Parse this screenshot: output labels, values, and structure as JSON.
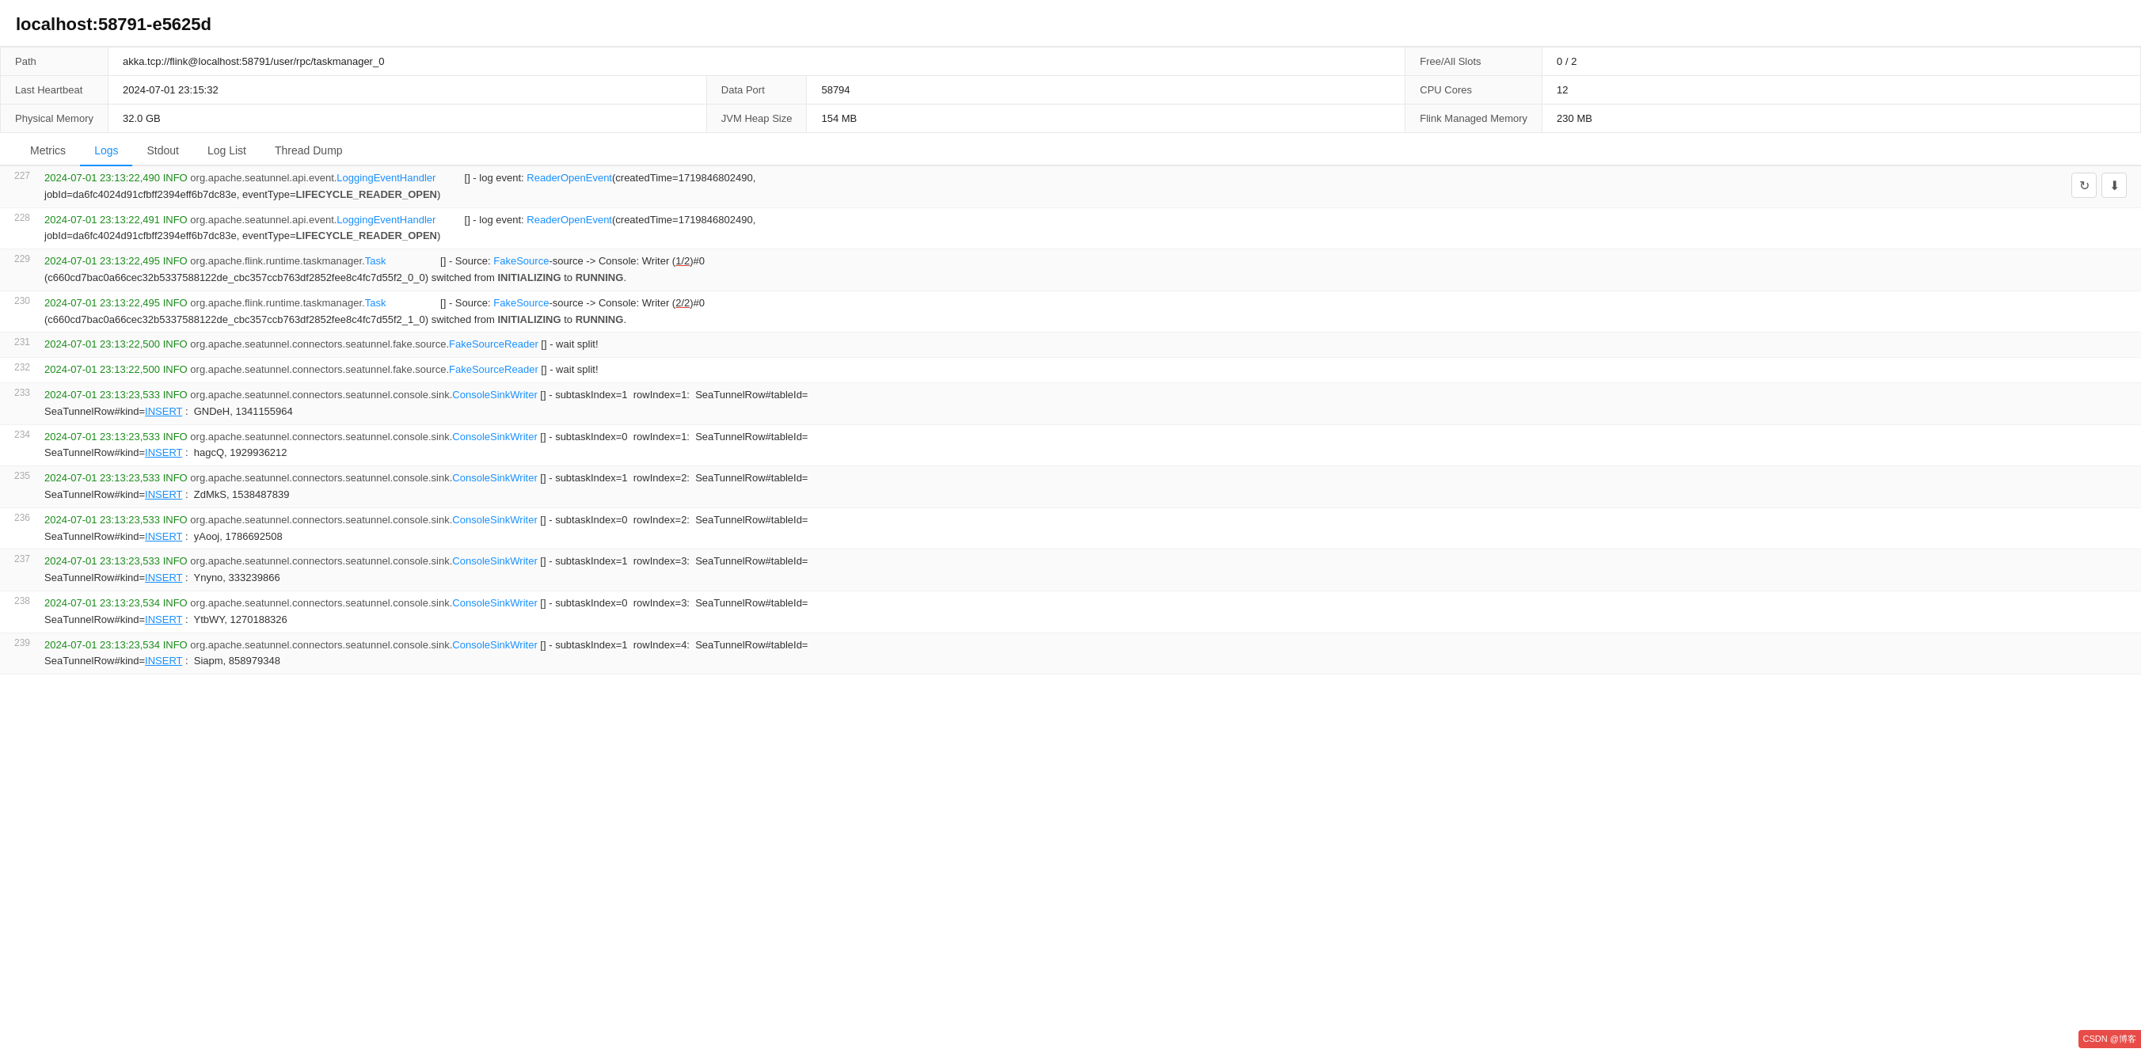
{
  "title": "localhost:58791-e5625d",
  "info": {
    "rows": [
      [
        {
          "label": "Path",
          "value": "akka.tcp://flink@localhost:58791/user/rpc/taskmanager_0"
        },
        {
          "label": "Free/All Slots",
          "value": "0 / 2"
        }
      ],
      [
        {
          "label": "Last Heartbeat",
          "value": "2024-07-01 23:15:32"
        },
        {
          "label": "Data Port",
          "value": "58794"
        },
        {
          "label": "CPU Cores",
          "value": "12"
        }
      ],
      [
        {
          "label": "Physical Memory",
          "value": "32.0 GB"
        },
        {
          "label": "JVM Heap Size",
          "value": "154 MB"
        },
        {
          "label": "Flink Managed Memory",
          "value": "230 MB"
        }
      ]
    ]
  },
  "tabs": [
    {
      "label": "Metrics",
      "active": false
    },
    {
      "label": "Logs",
      "active": true
    },
    {
      "label": "Stdout",
      "active": false
    },
    {
      "label": "Log List",
      "active": false
    },
    {
      "label": "Thread Dump",
      "active": false
    }
  ],
  "logs": [
    {
      "num": "227",
      "lines": [
        "2024-07-01 23:13:22,490 INFO  org.apache.seatunnel.api.event.LoggingEventHandler          [] - log event: ReaderOpenEvent(createdTime=1719846802490,",
        "jobId=da6fc4024d91cfbff2394eff6b7dc83e, eventType=LIFECYCLE_READER_OPEN)"
      ]
    },
    {
      "num": "228",
      "lines": [
        "2024-07-01 23:13:22,491 INFO  org.apache.seatunnel.api.event.LoggingEventHandler          [] - log event: ReaderOpenEvent(createdTime=1719846802490,",
        "jobId=da6fc4024d91cfbff2394eff6b7dc83e, eventType=LIFECYCLE_READER_OPEN)"
      ]
    },
    {
      "num": "229",
      "lines": [
        "2024-07-01 23:13:22,495 INFO  org.apache.flink.runtime.taskmanager.Task                   [] - Source: FakeSource-source -> Console: Writer (1/2)#0",
        "(c660cd7bac0a66cec32b5337588122de_cbc357ccb763df2852fee8c4fc7d55f2_0_0) switched from INITIALIZING to RUNNING."
      ]
    },
    {
      "num": "230",
      "lines": [
        "2024-07-01 23:13:22,495 INFO  org.apache.flink.runtime.taskmanager.Task                   [] - Source: FakeSource-source -> Console: Writer (2/2)#0",
        "(c660cd7bac0a66cec32b5337588122de_cbc357ccb763df2852fee8c4fc7d55f2_1_0) switched from INITIALIZING to RUNNING."
      ]
    },
    {
      "num": "231",
      "lines": [
        "2024-07-01 23:13:22,500 INFO  org.apache.seatunnel.connectors.seatunnel.fake.source.FakeSourceReader [] - wait split!"
      ]
    },
    {
      "num": "232",
      "lines": [
        "2024-07-01 23:13:22,500 INFO  org.apache.seatunnel.connectors.seatunnel.fake.source.FakeSourceReader [] - wait split!"
      ]
    },
    {
      "num": "233",
      "lines": [
        "2024-07-01 23:13:23,533 INFO  org.apache.seatunnel.connectors.seatunnel.console.sink.ConsoleSinkWriter [] - subtaskIndex=1  rowIndex=1:  SeaTunnelRow#tableId=",
        "SeaTunnelRow#kind=INSERT :  GNDeH, 1341155964"
      ]
    },
    {
      "num": "234",
      "lines": [
        "2024-07-01 23:13:23,533 INFO  org.apache.seatunnel.connectors.seatunnel.console.sink.ConsoleSinkWriter [] - subtaskIndex=0  rowIndex=1:  SeaTunnelRow#tableId=",
        "SeaTunnelRow#kind=INSERT :  hagcQ, 1929936212"
      ]
    },
    {
      "num": "235",
      "lines": [
        "2024-07-01 23:13:23,533 INFO  org.apache.seatunnel.connectors.seatunnel.console.sink.ConsoleSinkWriter [] - subtaskIndex=1  rowIndex=2:  SeaTunnelRow#tableId=",
        "SeaTunnelRow#kind=INSERT :  ZdMkS, 1538487839"
      ]
    },
    {
      "num": "236",
      "lines": [
        "2024-07-01 23:13:23,533 INFO  org.apache.seatunnel.connectors.seatunnel.console.sink.ConsoleSinkWriter [] - subtaskIndex=0  rowIndex=2:  SeaTunnelRow#tableId=",
        "SeaTunnelRow#kind=INSERT :  yAooj, 1786692508"
      ]
    },
    {
      "num": "237",
      "lines": [
        "2024-07-01 23:13:23,533 INFO  org.apache.seatunnel.connectors.seatunnel.console.sink.ConsoleSinkWriter [] - subtaskIndex=1  rowIndex=3:  SeaTunnelRow#tableId=",
        "SeaTunnelRow#kind=INSERT :  Ynyno, 333239866"
      ]
    },
    {
      "num": "238",
      "lines": [
        "2024-07-01 23:13:23,534 INFO  org.apache.seatunnel.connectors.seatunnel.console.sink.ConsoleSinkWriter [] - subtaskIndex=0  rowIndex=3:  SeaTunnelRow#tableId=",
        "SeaTunnelRow#kind=INSERT :  YtbWY, 1270188326"
      ]
    },
    {
      "num": "239",
      "lines": [
        "2024-07-01 23:13:23,534 INFO  org.apache.seatunnel.connectors.seatunnel.console.sink.ConsoleSinkWriter [] - subtaskIndex=1  rowIndex=4:  SeaTunnelRow#tableId=",
        "SeaTunnelRow#kind=INSERT :  Siapm, 858979348"
      ]
    }
  ],
  "controls": {
    "refresh": "↻",
    "download": "⬇"
  }
}
